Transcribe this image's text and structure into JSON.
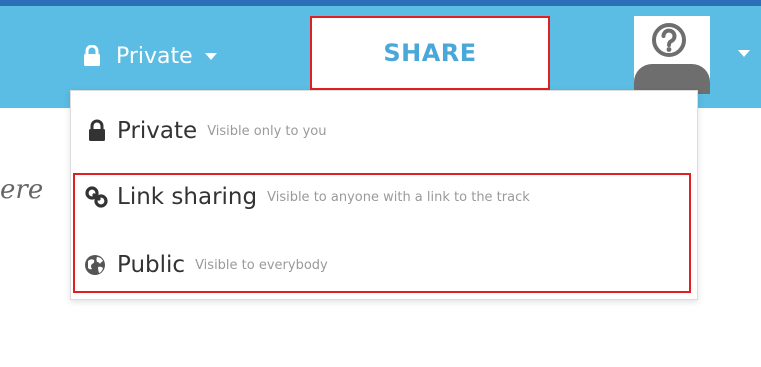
{
  "header": {
    "privacy_label": "Private",
    "share_label": "SHARE"
  },
  "background": {
    "partial_text": "ere"
  },
  "privacy_menu": {
    "options": [
      {
        "label": "Private",
        "description": "Visible only to you",
        "icon": "lock-icon"
      },
      {
        "label": "Link sharing",
        "description": "Visible to anyone with a link to the track",
        "icon": "link-icon"
      },
      {
        "label": "Public",
        "description": "Visible to everybody",
        "icon": "globe-icon"
      }
    ]
  },
  "colors": {
    "header_bg": "#5bbde3",
    "accent_text": "#4aa8d8",
    "highlight_border": "#e02020",
    "top_line": "#2a6fb8"
  }
}
